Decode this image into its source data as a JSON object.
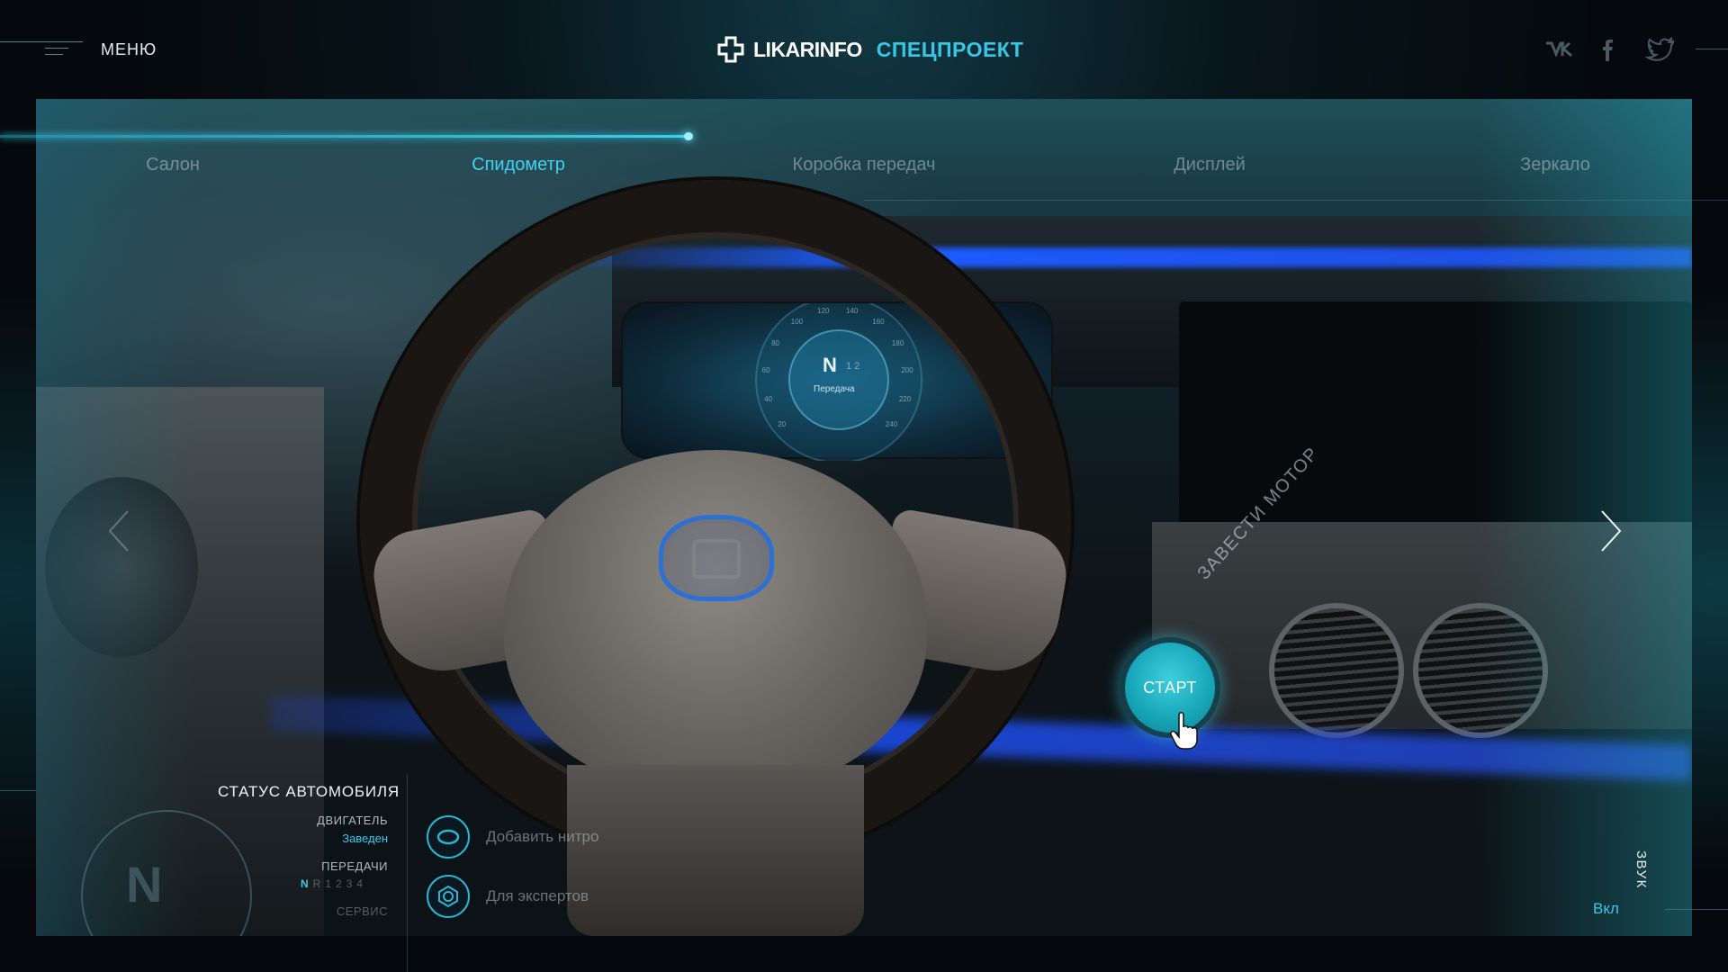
{
  "header": {
    "menu_label": "МЕНЮ",
    "logo_text": "LIKARINFO",
    "logo_sub": "СПЕЦПРОЕКТ",
    "social": [
      "vk-icon",
      "facebook-icon",
      "twitter-icon"
    ]
  },
  "tabs": [
    {
      "label": "Салон",
      "active": false
    },
    {
      "label": "Спидометр",
      "active": true
    },
    {
      "label": "Коробка передач",
      "active": false
    },
    {
      "label": "Дисплей",
      "active": false
    },
    {
      "label": "Зеркало",
      "active": false
    }
  ],
  "progress": 0.4,
  "start_button": {
    "label": "СТАРТ",
    "hint": "ЗАВЕСТИ МОТОР"
  },
  "cluster": {
    "gear": "N",
    "gear_next": "1 2",
    "label": "Передача",
    "ticks": [
      "20",
      "40",
      "60",
      "80",
      "100",
      "120",
      "140",
      "160",
      "180",
      "200",
      "220",
      "240"
    ]
  },
  "status": {
    "title": "СТАТУС АВТОМОБИЛЯ",
    "engine_label": "ДВИГАТЕЛЬ",
    "engine_value": "Заведен",
    "gears_label": "ПЕРЕДАЧИ",
    "gears": [
      "N",
      "R",
      "1",
      "2",
      "3",
      "4"
    ],
    "active_gear": "N",
    "service_label": "СЕРВИС",
    "gauge_letter": "N"
  },
  "options": [
    {
      "label": "Добавить нитро",
      "icon": "nitro-icon"
    },
    {
      "label": "Для экспертов",
      "icon": "expert-icon"
    }
  ],
  "sound": {
    "label": "ЗВУК",
    "value": "Вкл"
  },
  "colors": {
    "accent": "#3cc8ea",
    "start_button": "#1fb2c4",
    "emblem": "#2d6fd6"
  }
}
